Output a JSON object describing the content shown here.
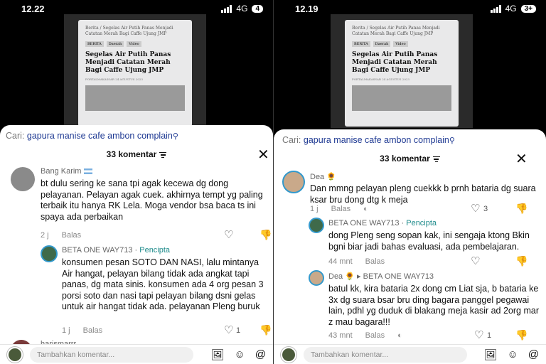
{
  "left": {
    "status": {
      "time": "12.22",
      "network": "4G",
      "badge": "4"
    },
    "video": {
      "crumb": "Berita / Segelas Air Putih Panas Menjadi Catatan Merah Bagi Caffe Ujung JMP",
      "tags": [
        "BERITA",
        "Daerah",
        "Video"
      ],
      "headline": "Segelas Air Putih Panas Menjadi Catatan Merah Bagi Caffe Ujung JMP",
      "meta": "PORTALMAKASSAR   24 AGUSTUS 2023"
    },
    "search": {
      "prefix": "Cari:",
      "query": "gapura manise cafe ambon complain"
    },
    "count_label": "33 komentar",
    "comments": [
      {
        "author": "Bang Karim",
        "text": "bt dulu sering ke sana tpi agak kecewa dg dong pelayanan. Pelayan agak cuek. akhirnya tempt yg paling terbaik itu hanya RK Lela. Moga vendor bsa baca ts ini spaya ada perbaikan",
        "time": "2 j",
        "reply": "Balas"
      },
      {
        "author": "BETA ONE WAY713",
        "tag": "Pencipta",
        "text": "konsumen pesan SOTO DAN NASI, lalu mintanya Air hangat, pelayan bilang tidak ada angkat tapi panas, dg mata sinis. konsumen ada 4 org pesan 3 porsi soto dan nasi tapi pelayan bilang dsni gelas untuk air hangat tidak ada. pelayanan Pleng buruk",
        "time": "1 j",
        "reply": "Balas",
        "likes": "1"
      }
    ],
    "next_author": "harismarrr",
    "placeholder": "Tambahkan komentar..."
  },
  "right": {
    "status": {
      "time": "12.19",
      "network": "4G",
      "badge": "3+"
    },
    "video": {
      "crumb": "Berita / Segelas Air Putih Panas Menjadi Catatan Merah Bagi Caffe Ujung JMP",
      "tags": [
        "BERITA",
        "Daerah",
        "Video"
      ],
      "headline": "Segelas Air Putih Panas Menjadi Catatan Merah Bagi Caffe Ujung JMP",
      "meta": "PORTALMAKASSAR   24 AGUSTUS 2023"
    },
    "search": {
      "prefix": "Cari:",
      "query": "gapura manise cafe ambon complain"
    },
    "count_label": "33 komentar",
    "comments": [
      {
        "author": "Dea",
        "text": "Dan mmng pelayan pleng cuekkk b prnh bataria dg suara ksar bru dong dtg k meja",
        "time": "1 j",
        "reply": "Balas",
        "likes": "3"
      },
      {
        "author": "BETA ONE WAY713",
        "tag": "Pencipta",
        "text": "dong Pleng seng sopan kak, ini sengaja ktong Bkin bgni biar jadi bahas evaluasi, ada pembelajaran.",
        "time": "44 mnt",
        "reply": "Balas"
      },
      {
        "author": "Dea",
        "reply_to": "BETA ONE WAY713",
        "text": "batul kk, kira bataria 2x dong cm Liat sja, b bataria ke 3x dg suara bsar bru ding bagara panggel pegawai lain, pdhl yg duduk di blakang meja kasir ad 2org mar z mau bagara!!!",
        "time": "43 mnt",
        "reply": "Balas",
        "likes": "1"
      }
    ],
    "placeholder": "Tambahkan komentar..."
  }
}
